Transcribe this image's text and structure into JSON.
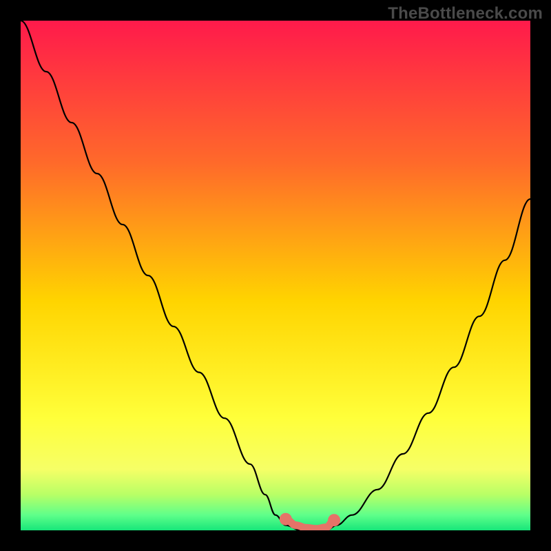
{
  "watermark": "TheBottleneck.com",
  "colors": {
    "frame": "#000000",
    "gradient_top": "#ff1a4b",
    "gradient_mid_upper": "#ff6a2a",
    "gradient_mid": "#ffd400",
    "gradient_lower": "#f6ff66",
    "gradient_green1": "#b8ff66",
    "gradient_green2": "#5fff8a",
    "gradient_green3": "#17e67a",
    "curve": "#000000",
    "salmon": "#e57368"
  },
  "chart_data": {
    "type": "line",
    "title": "",
    "xlabel": "",
    "ylabel": "",
    "xlim": [
      0,
      100
    ],
    "ylim": [
      0,
      100
    ],
    "series": [
      {
        "name": "bottleneck-curve",
        "x": [
          0,
          5,
          10,
          15,
          20,
          25,
          30,
          35,
          40,
          45,
          48,
          50,
          52,
          55,
          58,
          60,
          62,
          65,
          70,
          75,
          80,
          85,
          90,
          95,
          100
        ],
        "y": [
          100,
          90,
          80,
          70,
          60,
          50,
          40,
          31,
          22,
          13,
          7,
          3,
          1,
          0,
          0,
          0,
          1,
          3,
          8,
          15,
          23,
          32,
          42,
          53,
          65
        ]
      }
    ],
    "highlight": {
      "name": "optimal-range",
      "x": [
        52,
        54,
        56,
        58,
        60,
        61.5
      ],
      "y": [
        2.2,
        1.0,
        0.5,
        0.3,
        0.6,
        2.0
      ]
    }
  }
}
